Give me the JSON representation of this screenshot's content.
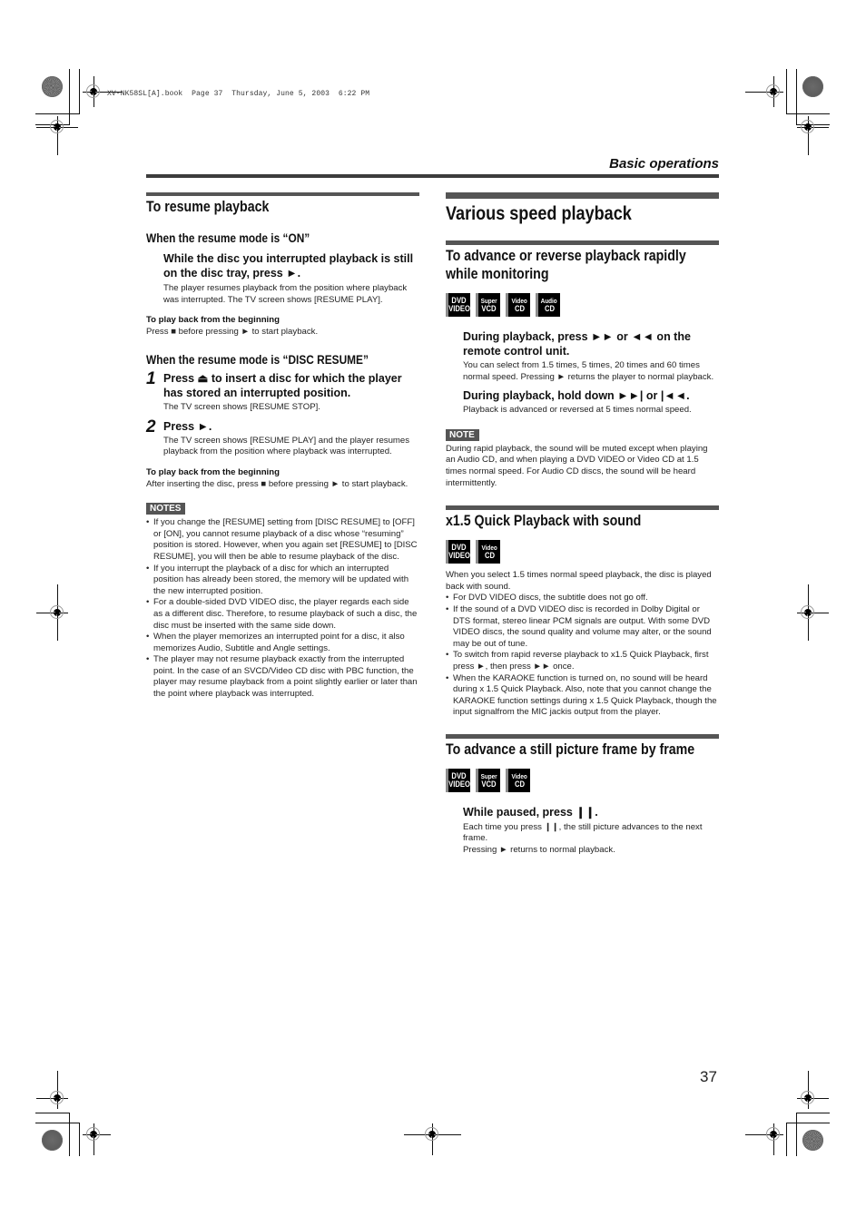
{
  "print_info": "XV-NK58SL[A].book  Page 37  Thursday, June 5, 2003  6:22 PM",
  "header": {
    "section_label": "Basic operations"
  },
  "page_number": "37",
  "left": {
    "title": "To resume playback",
    "on_mode": {
      "heading": "When the resume mode is “ON”",
      "step": "While the disc you interrupted playback is still on the disc tray, press ►.",
      "desc": "The player resumes playback from the position where playback was interrupted. The TV screen shows [RESUME PLAY].",
      "sub_heading": "To play back from the beginning",
      "sub_text": "Press ■ before pressing ► to start playback."
    },
    "disc_resume_mode": {
      "heading": "When the resume mode is “DISC RESUME”",
      "steps": [
        {
          "num": "1",
          "text": "Press ⏏ to insert a disc for which the player has stored an interrupted position.",
          "desc": "The TV screen shows [RESUME STOP]."
        },
        {
          "num": "2",
          "text": "Press ►.",
          "desc": "The TV screen shows [RESUME PLAY] and the player resumes playback from the position where playback was interrupted."
        }
      ],
      "sub_heading": "To play back from the beginning",
      "sub_text": "After inserting the disc, press ■ before pressing ► to start playback."
    },
    "notes": {
      "label": "NOTES",
      "items": [
        "If you change the [RESUME] setting from [DISC RESUME] to [OFF] or [ON], you cannot resume playback of a disc whose “resuming” position is stored. However, when you again set [RESUME] to [DISC RESUME], you will then be able to resume playback of the disc.",
        "If you interrupt the playback of a disc for which an interrupted position has already been stored, the memory will be updated with the new interrupted position.",
        "For a double-sided DVD VIDEO disc, the player regards each side as a different disc. Therefore, to resume playback of such a disc, the disc must be inserted with the same side down.",
        "When the player memorizes an interrupted point for a disc, it also memorizes Audio, Subtitle and Angle settings.",
        "The player may not resume playback exactly from the interrupted point. In the case of an SVCD/Video CD disc with PBC function, the player may resume playback from a point slightly earlier or later than the point where playback was interrupted."
      ]
    }
  },
  "right": {
    "title": "Various speed playback",
    "rapid": {
      "heading": "To advance or reverse playback rapidly while monitoring",
      "badges": [
        {
          "icon": "dvd-video-icon",
          "l1": "DVD",
          "l2": "VIDEO"
        },
        {
          "icon": "super-vcd-icon",
          "l1": "Super",
          "l2": "VCD"
        },
        {
          "icon": "video-cd-icon",
          "l1": "Video",
          "l2": "CD"
        },
        {
          "icon": "audio-cd-icon",
          "l1": "Audio",
          "l2": "CD"
        }
      ],
      "step1": "During playback, press ►► or ◄◄ on the remote control unit.",
      "desc1": "You can select from 1.5 times, 5 times, 20 times and 60 times normal speed. Pressing ► returns the player to normal playback.",
      "step2": "During playback, hold down ►►| or |◄◄.",
      "desc2": "Playback is advanced or reversed at 5 times normal speed.",
      "note_label": "NOTE",
      "note": "During rapid playback, the sound will be muted except when playing an Audio CD, and when playing a DVD VIDEO or Video CD at 1.5 times normal speed. For Audio CD discs, the sound will be heard intermittently."
    },
    "quick": {
      "heading": "x1.5 Quick Playback with sound",
      "badges": [
        {
          "icon": "dvd-video-icon",
          "l1": "DVD",
          "l2": "VIDEO"
        },
        {
          "icon": "video-cd-icon",
          "l1": "Video",
          "l2": "CD"
        }
      ],
      "intro": "When you select 1.5 times normal speed playback, the disc is played back with sound.",
      "items": [
        "For DVD VIDEO discs, the subtitle does not go off.",
        "If the sound of a DVD VIDEO disc is recorded in Dolby Digital or DTS format, stereo linear PCM signals are output. With some DVD VIDEO discs, the sound quality and volume may alter, or the sound may be out of tune.",
        "To switch from rapid reverse playback to x1.5 Quick Playback, first press ►, then press ►► once.",
        "When the KARAOKE function is turned on, no sound will be heard during x 1.5 Quick Playback. Also, note that you cannot change the KARAOKE function settings during x 1.5 Quick Playback, though the input signalfrom the MIC jackis output from the player."
      ]
    },
    "frame": {
      "heading": "To advance a still picture frame by frame",
      "badges": [
        {
          "icon": "dvd-video-icon",
          "l1": "DVD",
          "l2": "VIDEO"
        },
        {
          "icon": "super-vcd-icon",
          "l1": "Super",
          "l2": "VCD"
        },
        {
          "icon": "video-cd-icon",
          "l1": "Video",
          "l2": "CD"
        }
      ],
      "step": "While paused, press ❙❙.",
      "desc1": "Each time you press ❙❙, the still picture advances to the next frame.",
      "desc2": "Pressing ► returns to normal playback."
    }
  }
}
